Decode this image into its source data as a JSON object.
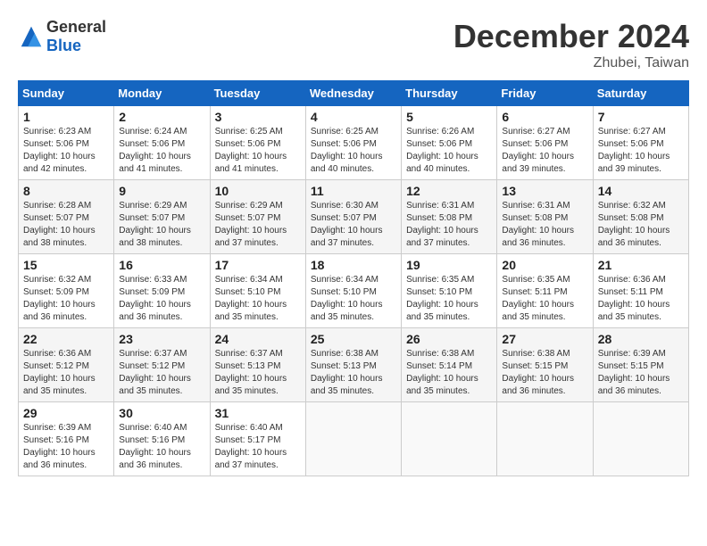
{
  "header": {
    "logo": {
      "general": "General",
      "blue": "Blue"
    },
    "title": "December 2024",
    "location": "Zhubei, Taiwan"
  },
  "calendar": {
    "weekdays": [
      "Sunday",
      "Monday",
      "Tuesday",
      "Wednesday",
      "Thursday",
      "Friday",
      "Saturday"
    ],
    "weeks": [
      [
        null,
        {
          "day": 2,
          "sunrise": "Sunrise: 6:24 AM",
          "sunset": "Sunset: 5:06 PM",
          "daylight": "Daylight: 10 hours and 41 minutes."
        },
        {
          "day": 3,
          "sunrise": "Sunrise: 6:25 AM",
          "sunset": "Sunset: 5:06 PM",
          "daylight": "Daylight: 10 hours and 41 minutes."
        },
        {
          "day": 4,
          "sunrise": "Sunrise: 6:25 AM",
          "sunset": "Sunset: 5:06 PM",
          "daylight": "Daylight: 10 hours and 40 minutes."
        },
        {
          "day": 5,
          "sunrise": "Sunrise: 6:26 AM",
          "sunset": "Sunset: 5:06 PM",
          "daylight": "Daylight: 10 hours and 40 minutes."
        },
        {
          "day": 6,
          "sunrise": "Sunrise: 6:27 AM",
          "sunset": "Sunset: 5:06 PM",
          "daylight": "Daylight: 10 hours and 39 minutes."
        },
        {
          "day": 7,
          "sunrise": "Sunrise: 6:27 AM",
          "sunset": "Sunset: 5:06 PM",
          "daylight": "Daylight: 10 hours and 39 minutes."
        }
      ],
      [
        {
          "day": 1,
          "sunrise": "Sunrise: 6:23 AM",
          "sunset": "Sunset: 5:06 PM",
          "daylight": "Daylight: 10 hours and 42 minutes."
        },
        {
          "day": 8,
          "sunrise": "Sunrise: 6:28 AM",
          "sunset": "Sunset: 5:07 PM",
          "daylight": "Daylight: 10 hours and 38 minutes."
        },
        {
          "day": 9,
          "sunrise": "Sunrise: 6:29 AM",
          "sunset": "Sunset: 5:07 PM",
          "daylight": "Daylight: 10 hours and 38 minutes."
        },
        {
          "day": 10,
          "sunrise": "Sunrise: 6:29 AM",
          "sunset": "Sunset: 5:07 PM",
          "daylight": "Daylight: 10 hours and 37 minutes."
        },
        {
          "day": 11,
          "sunrise": "Sunrise: 6:30 AM",
          "sunset": "Sunset: 5:07 PM",
          "daylight": "Daylight: 10 hours and 37 minutes."
        },
        {
          "day": 12,
          "sunrise": "Sunrise: 6:31 AM",
          "sunset": "Sunset: 5:08 PM",
          "daylight": "Daylight: 10 hours and 37 minutes."
        },
        {
          "day": 13,
          "sunrise": "Sunrise: 6:31 AM",
          "sunset": "Sunset: 5:08 PM",
          "daylight": "Daylight: 10 hours and 36 minutes."
        },
        {
          "day": 14,
          "sunrise": "Sunrise: 6:32 AM",
          "sunset": "Sunset: 5:08 PM",
          "daylight": "Daylight: 10 hours and 36 minutes."
        }
      ],
      [
        {
          "day": 15,
          "sunrise": "Sunrise: 6:32 AM",
          "sunset": "Sunset: 5:09 PM",
          "daylight": "Daylight: 10 hours and 36 minutes."
        },
        {
          "day": 16,
          "sunrise": "Sunrise: 6:33 AM",
          "sunset": "Sunset: 5:09 PM",
          "daylight": "Daylight: 10 hours and 36 minutes."
        },
        {
          "day": 17,
          "sunrise": "Sunrise: 6:34 AM",
          "sunset": "Sunset: 5:10 PM",
          "daylight": "Daylight: 10 hours and 35 minutes."
        },
        {
          "day": 18,
          "sunrise": "Sunrise: 6:34 AM",
          "sunset": "Sunset: 5:10 PM",
          "daylight": "Daylight: 10 hours and 35 minutes."
        },
        {
          "day": 19,
          "sunrise": "Sunrise: 6:35 AM",
          "sunset": "Sunset: 5:10 PM",
          "daylight": "Daylight: 10 hours and 35 minutes."
        },
        {
          "day": 20,
          "sunrise": "Sunrise: 6:35 AM",
          "sunset": "Sunset: 5:11 PM",
          "daylight": "Daylight: 10 hours and 35 minutes."
        },
        {
          "day": 21,
          "sunrise": "Sunrise: 6:36 AM",
          "sunset": "Sunset: 5:11 PM",
          "daylight": "Daylight: 10 hours and 35 minutes."
        }
      ],
      [
        {
          "day": 22,
          "sunrise": "Sunrise: 6:36 AM",
          "sunset": "Sunset: 5:12 PM",
          "daylight": "Daylight: 10 hours and 35 minutes."
        },
        {
          "day": 23,
          "sunrise": "Sunrise: 6:37 AM",
          "sunset": "Sunset: 5:12 PM",
          "daylight": "Daylight: 10 hours and 35 minutes."
        },
        {
          "day": 24,
          "sunrise": "Sunrise: 6:37 AM",
          "sunset": "Sunset: 5:13 PM",
          "daylight": "Daylight: 10 hours and 35 minutes."
        },
        {
          "day": 25,
          "sunrise": "Sunrise: 6:38 AM",
          "sunset": "Sunset: 5:13 PM",
          "daylight": "Daylight: 10 hours and 35 minutes."
        },
        {
          "day": 26,
          "sunrise": "Sunrise: 6:38 AM",
          "sunset": "Sunset: 5:14 PM",
          "daylight": "Daylight: 10 hours and 35 minutes."
        },
        {
          "day": 27,
          "sunrise": "Sunrise: 6:38 AM",
          "sunset": "Sunset: 5:15 PM",
          "daylight": "Daylight: 10 hours and 36 minutes."
        },
        {
          "day": 28,
          "sunrise": "Sunrise: 6:39 AM",
          "sunset": "Sunset: 5:15 PM",
          "daylight": "Daylight: 10 hours and 36 minutes."
        }
      ],
      [
        {
          "day": 29,
          "sunrise": "Sunrise: 6:39 AM",
          "sunset": "Sunset: 5:16 PM",
          "daylight": "Daylight: 10 hours and 36 minutes."
        },
        {
          "day": 30,
          "sunrise": "Sunrise: 6:40 AM",
          "sunset": "Sunset: 5:16 PM",
          "daylight": "Daylight: 10 hours and 36 minutes."
        },
        {
          "day": 31,
          "sunrise": "Sunrise: 6:40 AM",
          "sunset": "Sunset: 5:17 PM",
          "daylight": "Daylight: 10 hours and 37 minutes."
        },
        null,
        null,
        null,
        null
      ]
    ]
  }
}
